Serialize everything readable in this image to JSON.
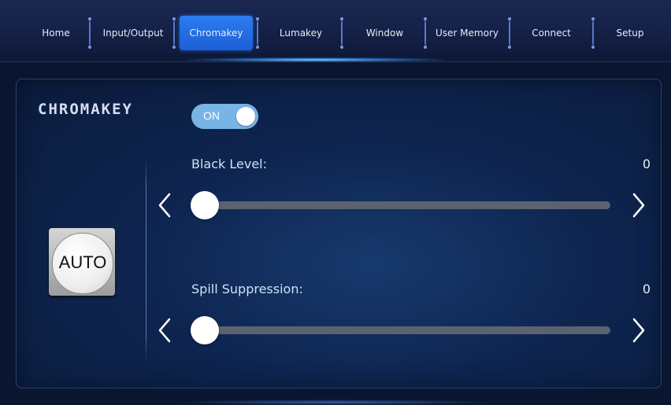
{
  "nav": {
    "tabs": [
      {
        "label": "Home"
      },
      {
        "label": "Input/Output"
      },
      {
        "label": "Chromakey"
      },
      {
        "label": "Lumakey"
      },
      {
        "label": "Window"
      },
      {
        "label": "User Memory"
      },
      {
        "label": "Connect"
      },
      {
        "label": "Setup"
      }
    ],
    "active": "Chromakey"
  },
  "section": {
    "title": "CHROMAKEY",
    "toggle": {
      "label": "ON",
      "state": true
    }
  },
  "auto_button": {
    "label": "AUTO"
  },
  "sliders": [
    {
      "label": "Black Level:",
      "value": "0",
      "fraction": 0
    },
    {
      "label": "Spill Suppression:",
      "value": "0",
      "fraction": 0
    }
  ],
  "colors": {
    "accent": "#2c7cf0",
    "toggle_on": "#78b4e6",
    "background": "#0a1630",
    "track": "#5b6270"
  },
  "icons": {
    "left_arrow": "chevron-left-icon",
    "right_arrow": "chevron-right-icon"
  }
}
